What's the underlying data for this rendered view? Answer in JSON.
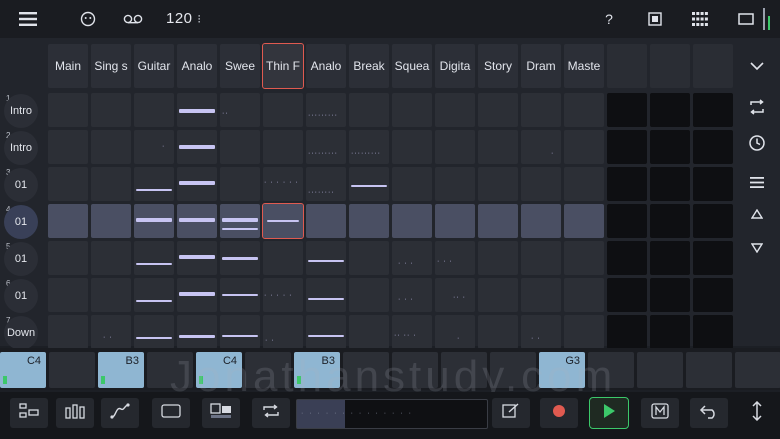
{
  "topbar": {
    "tempo": "120",
    "tempo_more": "⁝",
    "help": "?"
  },
  "tracks": [
    {
      "name": "Main"
    },
    {
      "name": "Sing s"
    },
    {
      "name": "Guitar"
    },
    {
      "name": "Analo"
    },
    {
      "name": "Swee"
    },
    {
      "name": "Thin F",
      "selected": true
    },
    {
      "name": "Analo"
    },
    {
      "name": "Break"
    },
    {
      "name": "Squea"
    },
    {
      "name": "Digita"
    },
    {
      "name": "Story"
    },
    {
      "name": "Dram"
    },
    {
      "name": "Maste"
    }
  ],
  "scenes": [
    {
      "num": "1",
      "label": "Intro"
    },
    {
      "num": "2",
      "label": "Intro"
    },
    {
      "num": "3",
      "label": "01"
    },
    {
      "num": "4",
      "label": "01",
      "selected": true
    },
    {
      "num": "5",
      "label": "01"
    },
    {
      "num": "6",
      "label": "01"
    },
    {
      "num": "7",
      "label": "Down"
    }
  ],
  "pads": [
    {
      "label": "C4",
      "on": true,
      "mark": true
    },
    {
      "label": "",
      "on": false
    },
    {
      "label": "B3",
      "on": true,
      "mark": true
    },
    {
      "label": "",
      "on": false
    },
    {
      "label": "C4",
      "on": true,
      "mark": true
    },
    {
      "label": "",
      "on": false
    },
    {
      "label": "B3",
      "on": true,
      "mark": true
    },
    {
      "label": "",
      "on": false
    },
    {
      "label": "",
      "on": false
    },
    {
      "label": "",
      "on": false
    },
    {
      "label": "",
      "on": false
    },
    {
      "label": "G3",
      "on": true,
      "mark": false
    },
    {
      "label": "",
      "on": false
    },
    {
      "label": "",
      "on": false
    },
    {
      "label": "",
      "on": false
    },
    {
      "label": "",
      "on": false
    }
  ],
  "watermark": "Jonathanstudy.com",
  "colors": {
    "accent_red": "#e05a50",
    "play_green": "#3cc86a",
    "clip": "#c7c4f2",
    "pad": "#8fb6d2"
  }
}
